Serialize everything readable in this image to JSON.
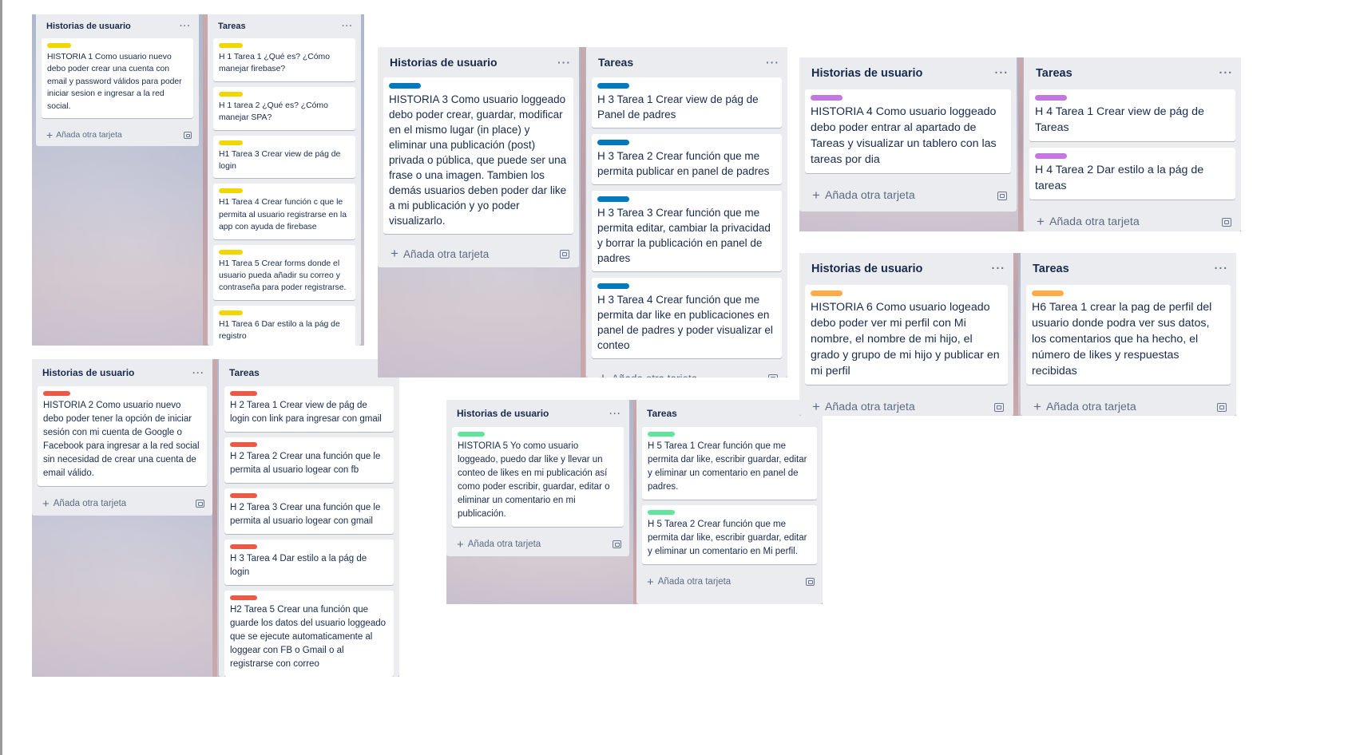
{
  "add_card_label": "Añada otra tarjeta",
  "colors": {
    "yellow": "#f2d600",
    "blue": "#0079bf",
    "purple": "#c377e0",
    "red": "#eb5a46",
    "green": "#61e49c",
    "orange": "#ffab4a",
    "list_bg": "#ebecf0"
  },
  "boards": [
    {
      "lists": [
        {
          "title": "Historias de usuario",
          "label_color": "yellow",
          "cards": [
            "HISTORIA 1 Como usuario nuevo debo poder crear una cuenta con email y password válidos para poder iniciar sesion e ingresar a la red social."
          ]
        },
        {
          "title": "Tareas",
          "label_color": "yellow",
          "cards": [
            "H 1 Tarea 1 ¿Qué es? ¿Cómo manejar firebase?",
            "H 1 tarea 2 ¿Qué es? ¿Cómo manejar SPA?",
            "H1 Tarea 3 Crear view de pág de login",
            "H1 Tarea 4 Crear función c que le permita al usuario registrarse en la app con ayuda de firebase",
            "H1 Tarea 5 Crear forms donde el usuario pueda añadir su correo y contraseña para poder registrarse.",
            "H1 Tarea 6 Dar estilo a la pág de registro"
          ]
        }
      ]
    },
    {
      "lists": [
        {
          "title": "Historias de usuario",
          "label_color": "red",
          "cards": [
            "HISTORIA 2 Como usuario nuevo debo poder tener la opción de iniciar sesión con mi cuenta de Google o Facebook para ingresar a la red social sin necesidad de crear una cuenta de email válido."
          ]
        },
        {
          "title": "Tareas",
          "label_color": "red",
          "cards": [
            "H 2 Tarea 1 Crear view de pág de login con link para ingresar con gmail",
            "H 2 Tarea 2 Crear una función que le permita al usuario logear con fb",
            "H 2 Tarea 3 Crear una función que le permita al usuario logear con gmail",
            "H 3 Tarea 4 Dar estilo a la pág de login",
            "H2 Tarea 5 Crear una función que guarde los datos del usuario loggeado que se ejecute automaticamente al loggear con FB o Gmail o al registrarse con correo"
          ]
        }
      ]
    },
    {
      "lists": [
        {
          "title": "Historias de usuario",
          "label_color": "blue",
          "cards": [
            "HISTORIA 3 Como usuario loggeado debo poder crear, guardar, modificar en el mismo lugar (in place) y eliminar una publicación (post) privada o pública, que puede ser una frase o una imagen. Tambien los demás usuarios deben poder dar like a mi publicación y yo poder visualizarlo."
          ]
        },
        {
          "title": "Tareas",
          "label_color": "blue",
          "cards": [
            "H 3 Tarea 1 Crear view de pág de Panel de padres",
            "H 3 Tarea 2 Crear función que me permita publicar en panel de padres",
            "H 3 Tarea 3 Crear función que me permita editar, cambiar la privacidad y borrar la publicación en panel de padres",
            "H 3 Tarea 4 Crear función que me permita dar like en publicaciones en panel de padres y poder visualizar el conteo"
          ]
        }
      ]
    },
    {
      "lists": [
        {
          "title": "Historias de usuario",
          "label_color": "green",
          "cards": [
            "HISTORIA 5 Yo como usuario loggeado, puedo dar like y llevar un conteo de likes en mi publicación así como poder escribir, guardar, editar o eliminar un comentario en mi publicación."
          ]
        },
        {
          "title": "Tareas",
          "label_color": "green",
          "cards": [
            "H 5 Tarea 1 Crear función que me permita dar like, escribir guardar, editar y eliminar un comentario en panel de padres.",
            "H 5 Tarea 2 Crear función que me permita dar like, escribir guardar, editar y eliminar un comentario en Mi perfil."
          ]
        }
      ]
    },
    {
      "lists": [
        {
          "title": "Historias de usuario",
          "label_color": "purple",
          "cards": [
            "HISTORIA 4 Como usuario loggeado debo poder entrar al apartado de Tareas y visualizar un tablero con las tareas por dia"
          ]
        },
        {
          "title": "Tareas",
          "label_color": "purple",
          "cards": [
            "H 4 Tarea 1 Crear view de pág de Tareas",
            "H 4 Tarea 2 Dar estilo a la pág de tareas"
          ]
        }
      ]
    },
    {
      "lists": [
        {
          "title": "Historias de usuario",
          "label_color": "orange",
          "cards": [
            "HISTORIA 6 Como usuario logeado debo poder ver mi perfil con Mi nombre, el nombre de mi hijo, el grado y grupo de mi hijo y publicar en mi perfil"
          ]
        },
        {
          "title": "Tareas",
          "label_color": "orange",
          "cards": [
            "H6 Tarea 1 crear la pag de perfil del usuario donde podra ver sus datos, los comentarios que ha hecho, el número de likes y respuestas recibidas"
          ]
        }
      ]
    }
  ]
}
